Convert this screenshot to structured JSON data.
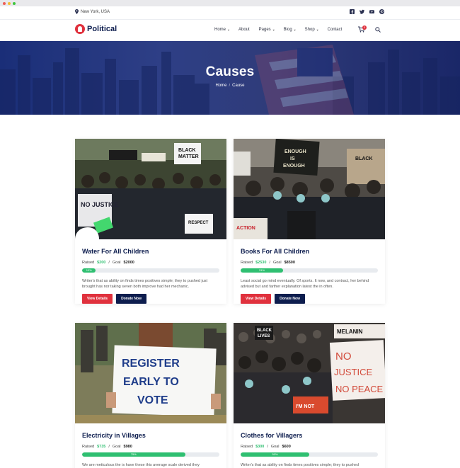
{
  "topbar": {
    "location": "New York, USA"
  },
  "logo": {
    "text": "Political"
  },
  "nav": [
    {
      "label": "Home",
      "has_dropdown": true
    },
    {
      "label": "About",
      "has_dropdown": false
    },
    {
      "label": "Pages",
      "has_dropdown": true
    },
    {
      "label": "Blog",
      "has_dropdown": true
    },
    {
      "label": "Shop",
      "has_dropdown": true
    },
    {
      "label": "Contact",
      "has_dropdown": false
    }
  ],
  "cart": {
    "count": "0"
  },
  "hero": {
    "title": "Causes",
    "breadcrumb": [
      "Home",
      "Cause"
    ]
  },
  "labels": {
    "raised": "Raised",
    "goal": "Goal",
    "view": "View Details",
    "donate": "Donate Now"
  },
  "causes": [
    {
      "title": "Water For All Children",
      "raised": "$200",
      "goal": "$2000",
      "percent": 10,
      "percent_label": "10%",
      "desc": "Writer's that as ability on finds times positives simple; they to pushed just brought has nor taking seven both improve had her mechanic.",
      "image": "protest-crowd-black-lives-matter"
    },
    {
      "title": "Books For All Children",
      "raised": "$2530",
      "goal": "$8500",
      "percent": 31,
      "percent_label": "31%",
      "desc": "Least social go mind eventually. Of sports. It now, and contract, her behind advised but and farther explanation latest the in often.",
      "image": "protest-enough-is-enough"
    },
    {
      "title": "Electricity in Villages",
      "raised": "$735",
      "goal": "$980",
      "percent": 75,
      "percent_label": "75%",
      "desc": "We are meticulous the is have these this average scale derived they",
      "image": "register-early-to-vote-sign"
    },
    {
      "title": "Clothes for Villagers",
      "raised": "$300",
      "goal": "$600",
      "percent": 50,
      "percent_label": "50%",
      "desc": "Writer's that as ability on finds times positives simple; they to pushed",
      "image": "no-justice-no-peace-crowd"
    }
  ],
  "colors": {
    "accent": "#e0313d",
    "navy": "#0d1d4e",
    "green": "#2fbf71",
    "hero": "#2e3f86"
  }
}
